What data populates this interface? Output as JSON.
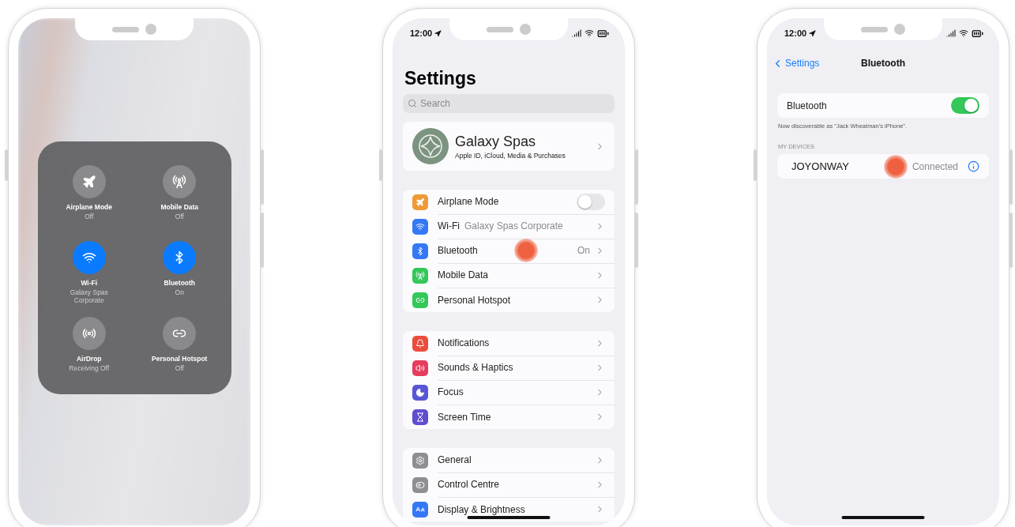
{
  "control_centre": {
    "toggles": [
      {
        "kind": "airplane",
        "label": "Airplane Mode",
        "status": "Off",
        "on": false
      },
      {
        "kind": "cellular",
        "label": "Mobile Data",
        "status": "Off",
        "on": false
      },
      {
        "kind": "wifi",
        "label": "Wi-Fi",
        "status": "Galaxy Spas Corporate",
        "on": true
      },
      {
        "kind": "bluetooth",
        "label": "Bluetooth",
        "status": "On",
        "on": true
      },
      {
        "kind": "airdrop",
        "label": "AirDrop",
        "status": "Receiving Off",
        "on": false
      },
      {
        "kind": "hotspot",
        "label": "Personal Hotspot",
        "status": "Off",
        "on": false
      }
    ]
  },
  "settings": {
    "status_bar": {
      "time": "12:00"
    },
    "title": "Settings",
    "search": {
      "placeholder": "Search"
    },
    "profile": {
      "name": "Galaxy Spas",
      "subtitle": "Apple ID, iCloud, Media & Purchases"
    },
    "groups": [
      [
        {
          "kind": "toggle",
          "color": "#f09a37",
          "label": "Airplane Mode",
          "on": false
        },
        {
          "kind": "link",
          "color": "#3478f6",
          "label": "Wi-Fi",
          "value": "Galaxy Spas Corporate"
        },
        {
          "kind": "link",
          "color": "#3478f6",
          "label": "Bluetooth",
          "value": "On",
          "tapped": true
        },
        {
          "kind": "link",
          "color": "#34c759",
          "label": "Mobile Data"
        },
        {
          "kind": "link",
          "color": "#34c759",
          "label": "Personal Hotspot"
        }
      ],
      [
        {
          "kind": "link",
          "color": "#eb4d3d",
          "label": "Notifications"
        },
        {
          "kind": "link",
          "color": "#e73c5e",
          "label": "Sounds & Haptics"
        },
        {
          "kind": "link",
          "color": "#5856d6",
          "label": "Focus"
        },
        {
          "kind": "link",
          "color": "#5e4ed0",
          "label": "Screen Time"
        }
      ],
      [
        {
          "kind": "link",
          "color": "#8e8e93",
          "label": "General"
        },
        {
          "kind": "link",
          "color": "#8e8e93",
          "label": "Control Centre"
        },
        {
          "kind": "link",
          "color": "#3478f6",
          "label": "Display & Brightness"
        }
      ]
    ]
  },
  "bluetooth": {
    "status_bar": {
      "time": "12:00"
    },
    "back": "Settings",
    "title": "Bluetooth",
    "toggle": {
      "label": "Bluetooth",
      "on": true
    },
    "note": "Now discoverable as \"Jack Wheatman's iPhone\".",
    "section": "MY DEVICES",
    "devices": [
      {
        "name": "JOYONWAY",
        "status": "Connected",
        "tapped": true
      }
    ]
  }
}
